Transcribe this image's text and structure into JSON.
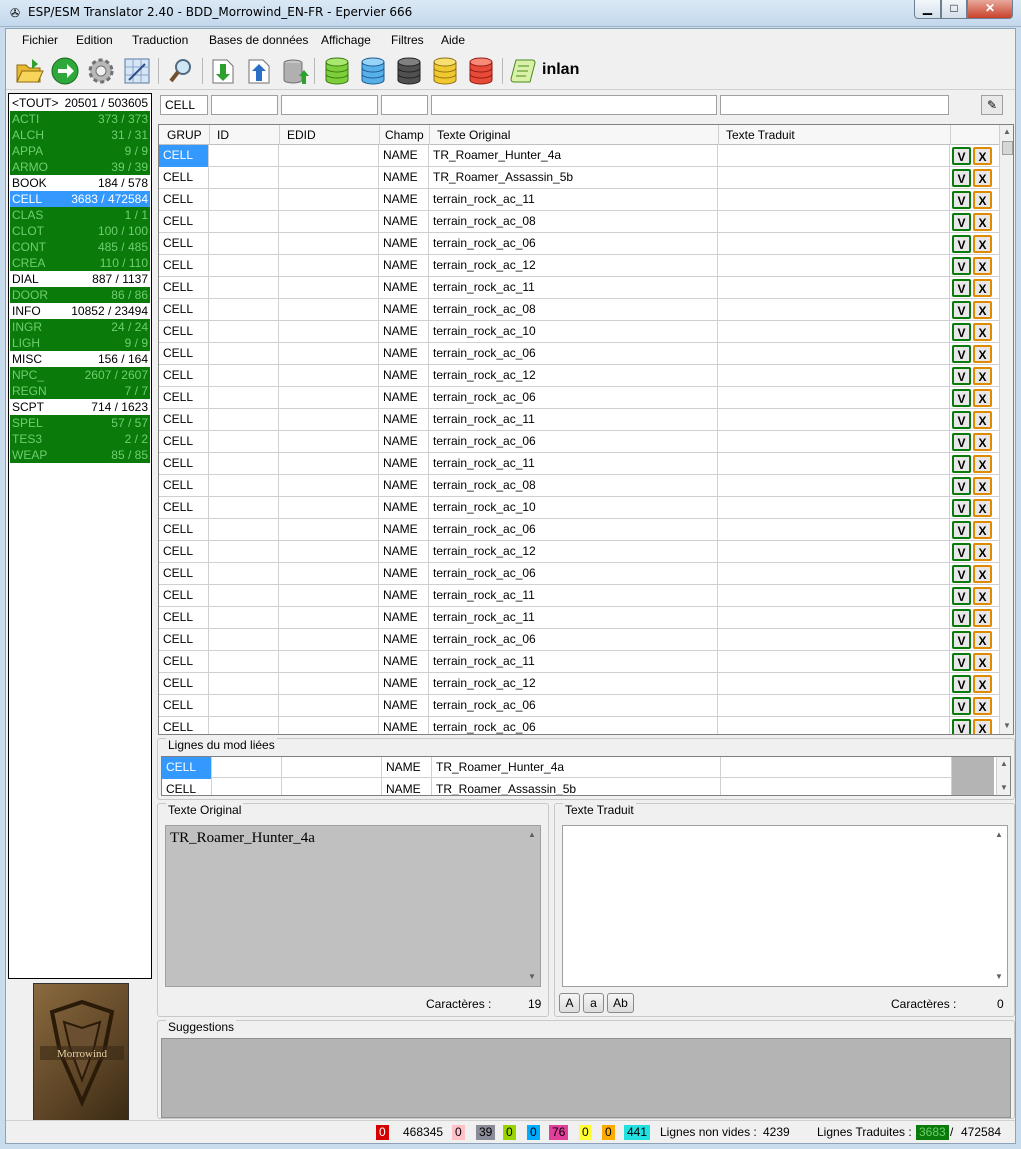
{
  "window": {
    "title": "ESP/ESM Translator 2.40 - BDD_Morrowind_EN-FR - Epervier 666"
  },
  "menu": [
    "Fichier",
    "Edition",
    "Traduction",
    "Bases de données",
    "Affichage",
    "Filtres",
    "Aide"
  ],
  "toolbar": {
    "text": "inlan",
    "icons": [
      "open-folder-icon",
      "go-arrow-icon",
      "gear-icon",
      "grid-edit-icon",
      "search-tool-icon",
      "import-icon",
      "export-icon",
      "database-upload-icon",
      "database-green-icon",
      "database-blue-icon",
      "database-black-icon",
      "database-yellow-icon",
      "database-red-icon",
      "scroll-icon"
    ]
  },
  "typelist": [
    {
      "name": "<TOUT>",
      "count": "20501 / 503605",
      "state": "white"
    },
    {
      "name": "ACTI",
      "count": "373 / 373",
      "state": "green"
    },
    {
      "name": "ALCH",
      "count": "31 / 31",
      "state": "green"
    },
    {
      "name": "APPA",
      "count": "9 / 9",
      "state": "green"
    },
    {
      "name": "ARMO",
      "count": "39 / 39",
      "state": "green"
    },
    {
      "name": "BOOK",
      "count": "184 / 578",
      "state": "white"
    },
    {
      "name": "CELL",
      "count": "3683 / 472584",
      "state": "sel"
    },
    {
      "name": "CLAS",
      "count": "1 / 1",
      "state": "green"
    },
    {
      "name": "CLOT",
      "count": "100 / 100",
      "state": "green"
    },
    {
      "name": "CONT",
      "count": "485 / 485",
      "state": "green"
    },
    {
      "name": "CREA",
      "count": "110 / 110",
      "state": "green"
    },
    {
      "name": "DIAL",
      "count": "887 / 1137",
      "state": "white"
    },
    {
      "name": "DOOR",
      "count": "86 / 86",
      "state": "green"
    },
    {
      "name": "INFO",
      "count": "10852 / 23494",
      "state": "white"
    },
    {
      "name": "INGR",
      "count": "24 / 24",
      "state": "green"
    },
    {
      "name": "LIGH",
      "count": "9 / 9",
      "state": "green"
    },
    {
      "name": "MISC",
      "count": "156 / 164",
      "state": "white"
    },
    {
      "name": "NPC_",
      "count": "2607 / 2607",
      "state": "green"
    },
    {
      "name": "REGN",
      "count": "7 / 7",
      "state": "green"
    },
    {
      "name": "SCPT",
      "count": "714 / 1623",
      "state": "white"
    },
    {
      "name": "SPEL",
      "count": "57 / 57",
      "state": "green"
    },
    {
      "name": "TES3",
      "count": "2 / 2",
      "state": "green"
    },
    {
      "name": "WEAP",
      "count": "85 / 85",
      "state": "green"
    }
  ],
  "cover": {
    "title": "Morrowind"
  },
  "filters": {
    "grup": "CELL",
    "id": "",
    "edid": "",
    "champ": "",
    "original": "",
    "traduit": ""
  },
  "grid": {
    "headers": [
      "GRUP",
      "ID",
      "EDID",
      "Champ",
      "Texte Original",
      "Texte Traduit"
    ],
    "v_label": "V",
    "x_label": "X",
    "rows": [
      {
        "grup": "CELL",
        "champ": "NAME",
        "original": "TR_Roamer_Hunter_4a"
      },
      {
        "grup": "CELL",
        "champ": "NAME",
        "original": "TR_Roamer_Assassin_5b"
      },
      {
        "grup": "CELL",
        "champ": "NAME",
        "original": "terrain_rock_ac_11"
      },
      {
        "grup": "CELL",
        "champ": "NAME",
        "original": "terrain_rock_ac_08"
      },
      {
        "grup": "CELL",
        "champ": "NAME",
        "original": "terrain_rock_ac_06"
      },
      {
        "grup": "CELL",
        "champ": "NAME",
        "original": "terrain_rock_ac_12"
      },
      {
        "grup": "CELL",
        "champ": "NAME",
        "original": "terrain_rock_ac_11"
      },
      {
        "grup": "CELL",
        "champ": "NAME",
        "original": "terrain_rock_ac_08"
      },
      {
        "grup": "CELL",
        "champ": "NAME",
        "original": "terrain_rock_ac_10"
      },
      {
        "grup": "CELL",
        "champ": "NAME",
        "original": "terrain_rock_ac_06"
      },
      {
        "grup": "CELL",
        "champ": "NAME",
        "original": "terrain_rock_ac_12"
      },
      {
        "grup": "CELL",
        "champ": "NAME",
        "original": "terrain_rock_ac_06"
      },
      {
        "grup": "CELL",
        "champ": "NAME",
        "original": "terrain_rock_ac_11"
      },
      {
        "grup": "CELL",
        "champ": "NAME",
        "original": "terrain_rock_ac_06"
      },
      {
        "grup": "CELL",
        "champ": "NAME",
        "original": "terrain_rock_ac_11"
      },
      {
        "grup": "CELL",
        "champ": "NAME",
        "original": "terrain_rock_ac_08"
      },
      {
        "grup": "CELL",
        "champ": "NAME",
        "original": "terrain_rock_ac_10"
      },
      {
        "grup": "CELL",
        "champ": "NAME",
        "original": "terrain_rock_ac_06"
      },
      {
        "grup": "CELL",
        "champ": "NAME",
        "original": "terrain_rock_ac_12"
      },
      {
        "grup": "CELL",
        "champ": "NAME",
        "original": "terrain_rock_ac_06"
      },
      {
        "grup": "CELL",
        "champ": "NAME",
        "original": "terrain_rock_ac_11"
      },
      {
        "grup": "CELL",
        "champ": "NAME",
        "original": "terrain_rock_ac_11"
      },
      {
        "grup": "CELL",
        "champ": "NAME",
        "original": "terrain_rock_ac_06"
      },
      {
        "grup": "CELL",
        "champ": "NAME",
        "original": "terrain_rock_ac_11"
      },
      {
        "grup": "CELL",
        "champ": "NAME",
        "original": "terrain_rock_ac_12"
      },
      {
        "grup": "CELL",
        "champ": "NAME",
        "original": "terrain_rock_ac_06"
      },
      {
        "grup": "CELL",
        "champ": "NAME",
        "original": "terrain_rock_ac_06"
      }
    ]
  },
  "linked": {
    "title": "Lignes du mod liées",
    "rows": [
      {
        "grup": "CELL",
        "champ": "NAME",
        "original": "TR_Roamer_Hunter_4a"
      },
      {
        "grup": "CELL",
        "champ": "NAME",
        "original": "TR_Roamer_Assassin_5b"
      }
    ]
  },
  "original_panel": {
    "title": "Texte Original",
    "text": "TR_Roamer_Hunter_4a",
    "char_label": "Caractères :",
    "char_count": "19"
  },
  "translated_panel": {
    "title": "Texte Traduit",
    "text": "",
    "char_label": "Caractères :",
    "char_count": "0",
    "case_buttons": [
      "A",
      "a",
      "Ab"
    ]
  },
  "suggestions": {
    "title": "Suggestions"
  },
  "status": {
    "counters": [
      {
        "value": "0",
        "bg": "#d40000",
        "fg": "#ffffff"
      },
      {
        "value": "468345",
        "bg": "#f0f0f0",
        "fg": "#000000"
      },
      {
        "value": "0",
        "bg": "#ffc0c8",
        "fg": "#000000"
      },
      {
        "value": "39",
        "bg": "#8a8a99",
        "fg": "#000000"
      },
      {
        "value": "0",
        "bg": "#9ad400",
        "fg": "#000000"
      },
      {
        "value": "0",
        "bg": "#00aaff",
        "fg": "#000000"
      },
      {
        "value": "76",
        "bg": "#e0409a",
        "fg": "#000000"
      },
      {
        "value": "0",
        "bg": "#ffff33",
        "fg": "#000000"
      },
      {
        "value": "0",
        "bg": "#ffaa00",
        "fg": "#000000"
      },
      {
        "value": "441",
        "bg": "#22e0e0",
        "fg": "#000000"
      }
    ],
    "nonempty_label": "Lignes non vides :",
    "nonempty_value": "4239",
    "translated_label": "Lignes Traduites :",
    "translated_value": "3683",
    "translated_sep": "/",
    "translated_total": "472584"
  }
}
